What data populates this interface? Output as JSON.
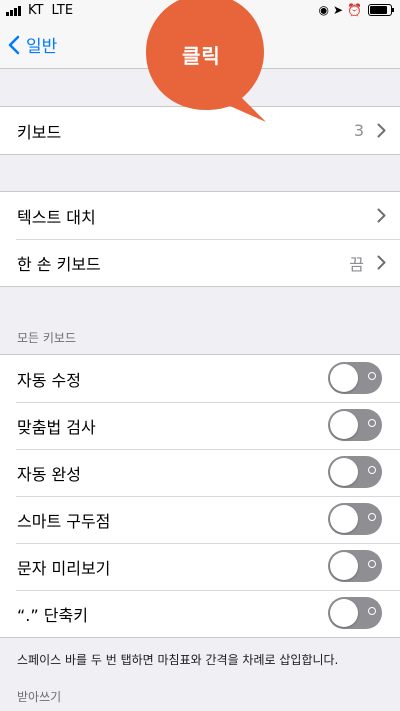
{
  "status_bar": {
    "carrier": "KT",
    "network": "LTE"
  },
  "nav": {
    "back_label": "일반"
  },
  "annotation": {
    "text": "클릭",
    "color": "#e8643a"
  },
  "keyboards_group": {
    "label": "키보드",
    "value": "3"
  },
  "text_group": {
    "items": [
      {
        "label": "텍스트 대치",
        "value": ""
      },
      {
        "label": "한 손 키보드",
        "value": "끔"
      }
    ]
  },
  "all_keyboards": {
    "header": "모든 키보드",
    "toggles": [
      {
        "label": "자동 수정",
        "on": false
      },
      {
        "label": "맞춤법 검사",
        "on": false
      },
      {
        "label": "자동 완성",
        "on": false
      },
      {
        "label": "스마트 구두점",
        "on": false
      },
      {
        "label": "문자 미리보기",
        "on": false
      },
      {
        "label": "“.” 단축키",
        "on": false
      }
    ],
    "footer": "스페이스 바를 두 번 탭하면 마침표와 간격을 차례로 삽입합니다."
  },
  "dictation": {
    "header": "받아쓰기"
  },
  "colors": {
    "accent": "#007aff",
    "toggle_off": "#8e8e93",
    "background": "#efeff4"
  }
}
